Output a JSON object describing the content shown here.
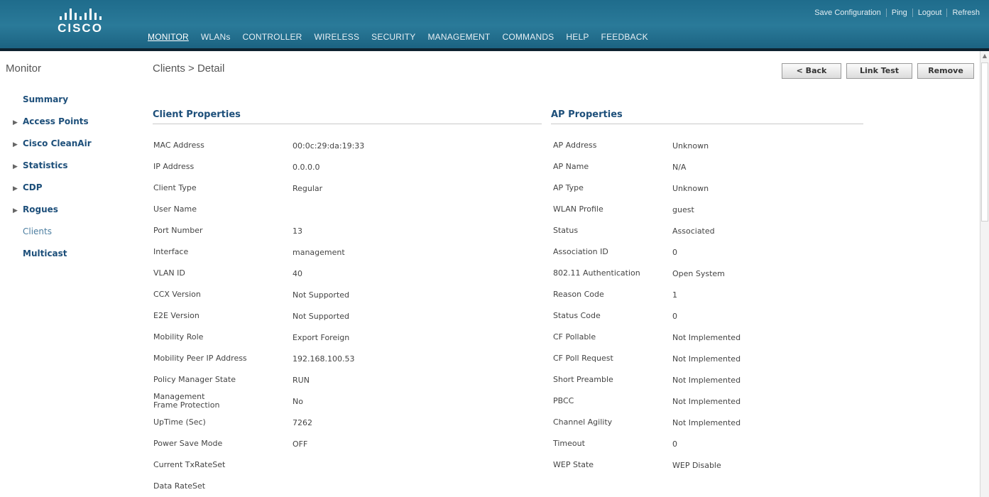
{
  "brand": {
    "name": "CISCO"
  },
  "top_links": [
    "Save Configuration",
    "Ping",
    "Logout",
    "Refresh"
  ],
  "menu": [
    "MONITOR",
    "WLANs",
    "CONTROLLER",
    "WIRELESS",
    "SECURITY",
    "MANAGEMENT",
    "COMMANDS",
    "HELP",
    "FEEDBACK"
  ],
  "nav": {
    "title": "Monitor",
    "items": [
      {
        "label": "Summary",
        "arrow": ""
      },
      {
        "label": "Access Points",
        "arrow": "▶"
      },
      {
        "label": "Cisco CleanAir",
        "arrow": "▶"
      },
      {
        "label": "Statistics",
        "arrow": "▶"
      },
      {
        "label": "CDP",
        "arrow": "▶"
      },
      {
        "label": "Rogues",
        "arrow": "▶"
      },
      {
        "label": "Clients",
        "arrow": ""
      },
      {
        "label": "Multicast",
        "arrow": ""
      }
    ]
  },
  "page": {
    "title": "Clients > Detail",
    "buttons": {
      "back": "< Back",
      "link_test": "Link Test",
      "remove": "Remove"
    }
  },
  "client_properties": {
    "heading": "Client Properties",
    "rows": [
      {
        "label": "MAC Address",
        "value": "00:0c:29:da:19:33"
      },
      {
        "label": "IP Address",
        "value": "0.0.0.0"
      },
      {
        "label": "Client Type",
        "value": "Regular"
      },
      {
        "label": "User Name",
        "value": ""
      },
      {
        "label": "Port Number",
        "value": "13"
      },
      {
        "label": "Interface",
        "value": "management"
      },
      {
        "label": "VLAN ID",
        "value": "40"
      },
      {
        "label": "CCX Version",
        "value": "Not Supported"
      },
      {
        "label": "E2E Version",
        "value": "Not Supported"
      },
      {
        "label": "Mobility Role",
        "value": "Export Foreign"
      },
      {
        "label": "Mobility Peer IP Address",
        "value": "192.168.100.53"
      },
      {
        "label": "Policy Manager State",
        "value": "RUN"
      },
      {
        "label": "Management Frame Protection",
        "value": "No"
      },
      {
        "label": "UpTime (Sec)",
        "value": "7262"
      },
      {
        "label": "Power Save Mode",
        "value": "OFF"
      },
      {
        "label": "Current TxRateSet",
        "value": ""
      },
      {
        "label": "Data RateSet",
        "value": ""
      }
    ]
  },
  "ap_properties": {
    "heading": "AP Properties",
    "rows": [
      {
        "label": "AP Address",
        "value": "Unknown"
      },
      {
        "label": "AP Name",
        "value": "N/A"
      },
      {
        "label": "AP Type",
        "value": "Unknown"
      },
      {
        "label": "WLAN Profile",
        "value": "guest"
      },
      {
        "label": "Status",
        "value": "Associated"
      },
      {
        "label": "Association ID",
        "value": "0"
      },
      {
        "label": "802.11 Authentication",
        "value": "Open System"
      },
      {
        "label": "Reason Code",
        "value": "1"
      },
      {
        "label": "Status Code",
        "value": "0"
      },
      {
        "label": "CF Pollable",
        "value": "Not Implemented"
      },
      {
        "label": "CF Poll Request",
        "value": "Not Implemented"
      },
      {
        "label": "Short Preamble",
        "value": "Not Implemented"
      },
      {
        "label": "PBCC",
        "value": "Not Implemented"
      },
      {
        "label": "Channel Agility",
        "value": "Not Implemented"
      },
      {
        "label": "Timeout",
        "value": "0"
      },
      {
        "label": "WEP State",
        "value": "WEP Disable"
      }
    ]
  }
}
